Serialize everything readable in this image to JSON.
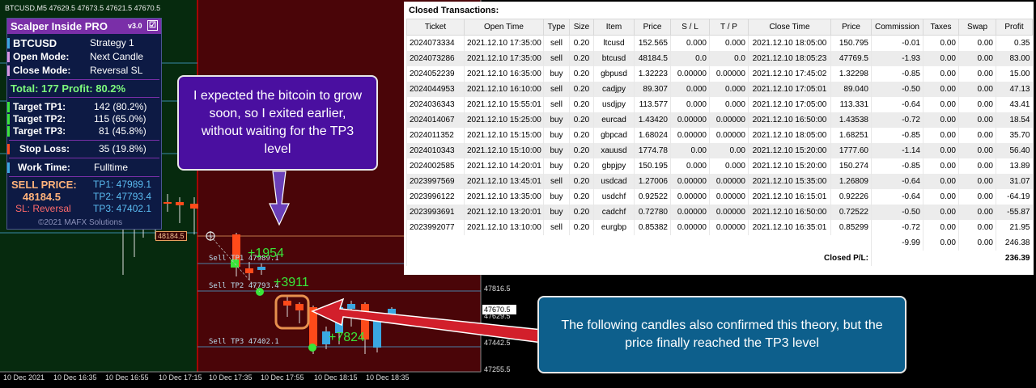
{
  "chart": {
    "header": "BTCUSD,M5   47629.5 47673.5 47621.5 47670.5",
    "price_ticks": [
      "47816.5",
      "47629.5",
      "47442.5",
      "47255.5"
    ],
    "current_price": "47670.5",
    "time_ticks": [
      "10 Dec 2021",
      "10 Dec 16:35",
      "10 Dec 16:55",
      "10 Dec 17:15",
      "10 Dec 17:35",
      "10 Dec 17:55",
      "10 Dec 18:15",
      "10 Dec 18:35"
    ],
    "entry_label": "48184.5",
    "level_labels": {
      "tp1": "Sell TP1 47989.1",
      "tp2": "Sell TP2 47793.4",
      "tp3": "Sell TP3 47402.1"
    },
    "points": {
      "tp1": "+1954",
      "tp2": "+3911",
      "tp3": "+7824"
    },
    "colors": {
      "bull": "#3aa7e0",
      "bear": "#ff4a1a",
      "sell_zone": "#4a0508",
      "buy_zone": "#062a0e"
    }
  },
  "panel": {
    "title": "Scalper Inside PRO",
    "version": "v3.0",
    "check": "☑",
    "symbol": "BTCUSD",
    "strategy": "Strategy 1",
    "open_mode_label": "Open Mode:",
    "open_mode": "Next Candle",
    "close_mode_label": "Close Mode:",
    "close_mode": "Reversal SL",
    "total": "Total: 177  Profit: 80.2%",
    "tp1_label": "Target TP1:",
    "tp1_val": "142 (80.2%)",
    "tp2_label": "Target TP2:",
    "tp2_val": "115 (65.0%)",
    "tp3_label": "Target TP3:",
    "tp3_val": "81 (45.8%)",
    "sl_label": "Stop Loss:",
    "sl_val": "35 (19.8%)",
    "work_label": "Work Time:",
    "work_val": "Fulltime",
    "sell_label": "SELL PRICE:",
    "sell_price": "48184.5",
    "sl_mode": "SL: Reversal",
    "tp1_price": "TP1: 47989.1",
    "tp2_price": "TP2: 47793.4",
    "tp3_price": "TP3: 47402.1",
    "copyright": "©2021 MAFX Solutions"
  },
  "transactions": {
    "title": "Closed Transactions:",
    "columns": [
      "Ticket",
      "Open Time",
      "Type",
      "Size",
      "Item",
      "Price",
      "S / L",
      "T / P",
      "Close Time",
      "Price",
      "Commission",
      "Taxes",
      "Swap",
      "Profit"
    ],
    "rows": [
      [
        "2024073334",
        "2021.12.10 17:35:00",
        "sell",
        "0.20",
        "ltcusd",
        "152.565",
        "0.000",
        "0.000",
        "2021.12.10 18:05:00",
        "150.795",
        "-0.01",
        "0.00",
        "0.00",
        "0.35"
      ],
      [
        "2024073286",
        "2021.12.10 17:35:00",
        "sell",
        "0.20",
        "btcusd",
        "48184.5",
        "0.0",
        "0.0",
        "2021.12.10 18:05:23",
        "47769.5",
        "-1.93",
        "0.00",
        "0.00",
        "83.00"
      ],
      [
        "2024052239",
        "2021.12.10 16:35:00",
        "buy",
        "0.20",
        "gbpusd",
        "1.32223",
        "0.00000",
        "0.00000",
        "2021.12.10 17:45:02",
        "1.32298",
        "-0.85",
        "0.00",
        "0.00",
        "15.00"
      ],
      [
        "2024044953",
        "2021.12.10 16:10:00",
        "sell",
        "0.20",
        "cadjpy",
        "89.307",
        "0.000",
        "0.000",
        "2021.12.10 17:05:01",
        "89.040",
        "-0.50",
        "0.00",
        "0.00",
        "47.13"
      ],
      [
        "2024036343",
        "2021.12.10 15:55:01",
        "sell",
        "0.20",
        "usdjpy",
        "113.577",
        "0.000",
        "0.000",
        "2021.12.10 17:05:00",
        "113.331",
        "-0.64",
        "0.00",
        "0.00",
        "43.41"
      ],
      [
        "2024014067",
        "2021.12.10 15:25:00",
        "buy",
        "0.20",
        "eurcad",
        "1.43420",
        "0.00000",
        "0.00000",
        "2021.12.10 16:50:00",
        "1.43538",
        "-0.72",
        "0.00",
        "0.00",
        "18.54"
      ],
      [
        "2024011352",
        "2021.12.10 15:15:00",
        "buy",
        "0.20",
        "gbpcad",
        "1.68024",
        "0.00000",
        "0.00000",
        "2021.12.10 18:05:00",
        "1.68251",
        "-0.85",
        "0.00",
        "0.00",
        "35.70"
      ],
      [
        "2024010343",
        "2021.12.10 15:10:00",
        "buy",
        "0.20",
        "xauusd",
        "1774.78",
        "0.00",
        "0.00",
        "2021.12.10 15:20:00",
        "1777.60",
        "-1.14",
        "0.00",
        "0.00",
        "56.40"
      ],
      [
        "2024002585",
        "2021.12.10 14:20:01",
        "buy",
        "0.20",
        "gbpjpy",
        "150.195",
        "0.000",
        "0.000",
        "2021.12.10 15:20:00",
        "150.274",
        "-0.85",
        "0.00",
        "0.00",
        "13.89"
      ],
      [
        "2023997569",
        "2021.12.10 13:45:01",
        "sell",
        "0.20",
        "usdcad",
        "1.27006",
        "0.00000",
        "0.00000",
        "2021.12.10 15:35:00",
        "1.26809",
        "-0.64",
        "0.00",
        "0.00",
        "31.07"
      ],
      [
        "2023996122",
        "2021.12.10 13:35:00",
        "buy",
        "0.20",
        "usdchf",
        "0.92522",
        "0.00000",
        "0.00000",
        "2021.12.10 16:15:01",
        "0.92226",
        "-0.64",
        "0.00",
        "0.00",
        "-64.19"
      ],
      [
        "2023993691",
        "2021.12.10 13:20:01",
        "buy",
        "0.20",
        "cadchf",
        "0.72780",
        "0.00000",
        "0.00000",
        "2021.12.10 16:50:00",
        "0.72522",
        "-0.50",
        "0.00",
        "0.00",
        "-55.87"
      ],
      [
        "2023992077",
        "2021.12.10 13:10:00",
        "sell",
        "0.20",
        "eurgbp",
        "0.85382",
        "0.00000",
        "0.00000",
        "2021.12.10 16:35:01",
        "0.85299",
        "-0.72",
        "0.00",
        "0.00",
        "21.95"
      ]
    ],
    "totals": {
      "commission": "-9.99",
      "taxes": "0.00",
      "swap": "0.00",
      "profit": "246.38"
    },
    "closed_pl_label": "Closed P/L:",
    "closed_pl": "236.39"
  },
  "callouts": {
    "first": "I expected the bitcoin to grow soon, so I exited earlier, without waiting for the TP3 level",
    "second": "The following candles also confirmed this theory, but the price finally reached the TP3 level"
  }
}
